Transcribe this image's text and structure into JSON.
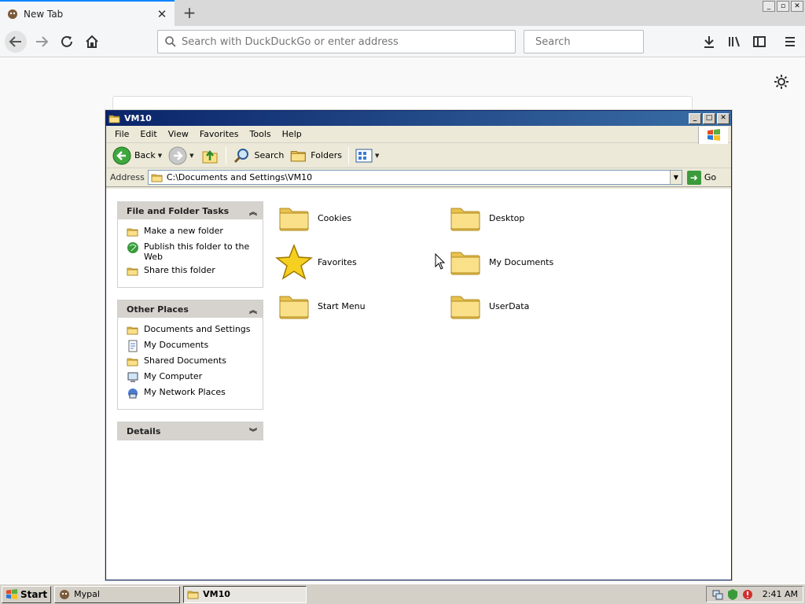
{
  "browser": {
    "tab_title": "New Tab",
    "url_placeholder": "Search with DuckDuckGo or enter address",
    "search_placeholder": "Search",
    "window_buttons": [
      "_",
      "▫",
      "✕"
    ]
  },
  "explorer": {
    "title": "VM10",
    "menu": [
      "File",
      "Edit",
      "View",
      "Favorites",
      "Tools",
      "Help"
    ],
    "toolbar": {
      "back_label": "Back",
      "search_label": "Search",
      "folders_label": "Folders"
    },
    "address": {
      "label": "Address",
      "value": "C:\\Documents and Settings\\VM10",
      "go_label": "Go"
    },
    "panels": {
      "tasks_title": "File and Folder Tasks",
      "tasks": [
        "Make a new folder",
        "Publish this folder to the Web",
        "Share this folder"
      ],
      "places_title": "Other Places",
      "places": [
        "Documents and Settings",
        "My Documents",
        "Shared Documents",
        "My Computer",
        "My Network Places"
      ],
      "details_title": "Details"
    },
    "items": [
      "Cookies",
      "Desktop",
      "Favorites",
      "My Documents",
      "Start Menu",
      "UserData"
    ]
  },
  "taskbar": {
    "start_label": "Start",
    "tasks": [
      "Mypal",
      "VM10"
    ],
    "clock": "2:41 AM"
  },
  "colors": {
    "titlebar_start": "#0a246a",
    "titlebar_end": "#3a6ea5",
    "folder_yellow": "#f2d46a",
    "taskbar_gray": "#d4d0c8"
  }
}
